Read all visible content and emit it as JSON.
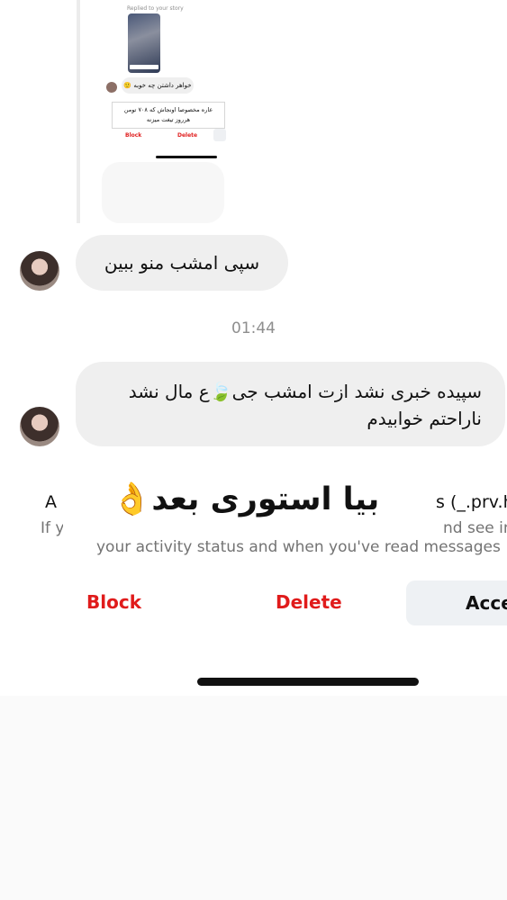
{
  "nested_screenshot": {
    "caption": "Replied to your story",
    "message": "خواهر داشتن چه خوبه 🙂",
    "card_line1": "عاره مخصوصا اونجاش که ۷۰۸ تومن",
    "card_line2": "هرروز تیغت میزنه",
    "block_label": "Block",
    "delete_label": "Delete"
  },
  "chat": {
    "message1": "سپی امشب منو ببین",
    "timestamp": "01:44",
    "message2_line1": "سپیده خبری نشد ازت امشب جی🍃ع مال نشد",
    "message2_line2": "ناراحتم خوابیدم"
  },
  "request": {
    "title_left_fragment": "A",
    "title_right_fragment": "s (_.prv.ha",
    "line1_left": "If y",
    "line1_right": "nd see info",
    "line2": "your activity status and when you've read messages",
    "overlay_text": "بیا استوری بعد",
    "overlay_emoji": "👌",
    "block_label": "Block",
    "delete_label": "Delete",
    "accept_label": "Acce"
  },
  "colors": {
    "danger": "#e01b1b",
    "bubble": "#efefef",
    "secondary_text": "#8e8e8e",
    "accept_bg": "#eef1f4"
  }
}
